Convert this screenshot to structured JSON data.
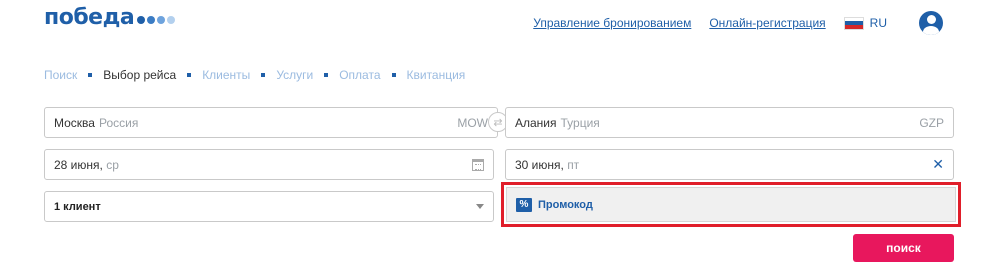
{
  "header": {
    "logo_text": "победа",
    "links": {
      "manage_booking": "Управление бронированием",
      "online_checkin": "Онлайн-регистрация"
    },
    "language": "RU",
    "user_icon": "user-circle-icon"
  },
  "steps": [
    {
      "label": "Поиск",
      "active": false
    },
    {
      "label": "Выбор рейса",
      "active": true
    },
    {
      "label": "Клиенты",
      "active": false
    },
    {
      "label": "Услуги",
      "active": false
    },
    {
      "label": "Оплата",
      "active": false
    },
    {
      "label": "Квитанция",
      "active": false
    }
  ],
  "form": {
    "origin": {
      "city": "Москва",
      "country": "Россия",
      "code": "MOW"
    },
    "destination": {
      "city": "Алания",
      "country": "Турция",
      "code": "GZP"
    },
    "swap_icon": "swap-arrows-icon",
    "depart_date": {
      "date": "28 июня,",
      "day": "ср"
    },
    "return_date": {
      "date": "30 июня,",
      "day": "пт"
    },
    "passengers": "1 клиент",
    "promo": {
      "icon": "%",
      "label": "Промокод"
    },
    "search_label": "поиск"
  },
  "colors": {
    "brand_blue": "#1f5fa8",
    "search_pink": "#e8175d",
    "highlight_red": "#e01e2a"
  }
}
